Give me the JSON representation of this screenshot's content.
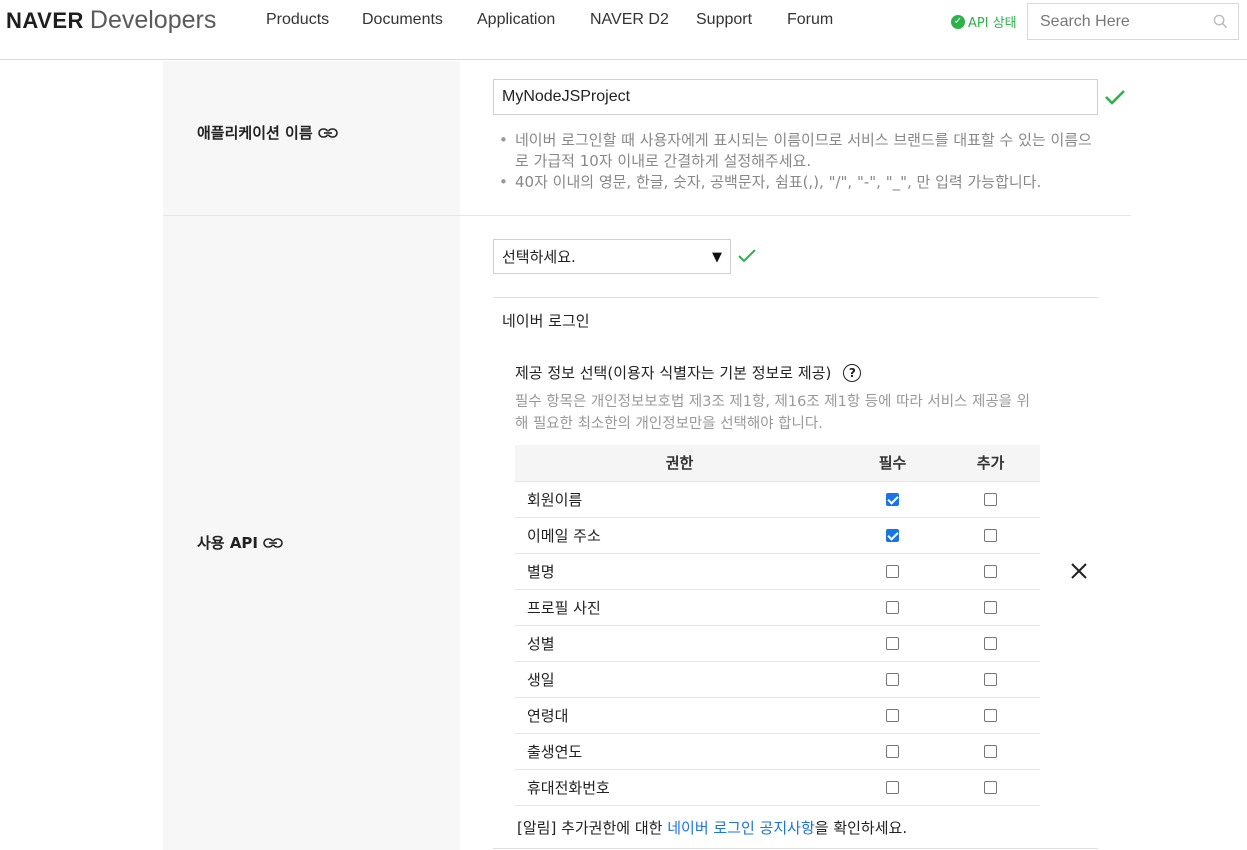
{
  "header": {
    "logo_brand": "NAVER",
    "logo_product": "Developers",
    "nav": [
      "Products",
      "Documents",
      "Application",
      "NAVER D2",
      "Support",
      "Forum"
    ],
    "api_status": "API 상태",
    "search_placeholder": "Search Here"
  },
  "form": {
    "app_name_label": "애플리케이션 이름",
    "app_name_value": "MyNodeJSProject",
    "app_name_notes": [
      "네이버 로그인할 때 사용자에게 표시되는 이름이므로 서비스 브랜드를 대표할 수 있는 이름으로 가급적 10자 이내로 간결하게 설정해주세요.",
      "40자 이내의 영문, 한글, 숫자, 공백문자, 쉼표(,), \"/\", \"-\", \"_\", 만 입력 가능합니다."
    ],
    "api_label": "사용 API",
    "select_value": "선택하세요.",
    "api_name": "네이버 로그인",
    "provide_title": "제공 정보 선택(이용자 식별자는 기본 정보로 제공)",
    "provide_desc": "필수 항목은 개인정보보호법 제3조 제1항, 제16조 제1항 등에 따라 서비스 제공을 위해 필요한 최소한의 개인정보만을 선택해야 합니다.",
    "table_headers": {
      "permission": "권한",
      "required": "필수",
      "additional": "추가"
    },
    "permissions": [
      {
        "name": "회원이름",
        "required": true,
        "additional": false
      },
      {
        "name": "이메일 주소",
        "required": true,
        "additional": false
      },
      {
        "name": "별명",
        "required": false,
        "additional": false
      },
      {
        "name": "프로필 사진",
        "required": false,
        "additional": false
      },
      {
        "name": "성별",
        "required": false,
        "additional": false
      },
      {
        "name": "생일",
        "required": false,
        "additional": false
      },
      {
        "name": "연령대",
        "required": false,
        "additional": false
      },
      {
        "name": "출생연도",
        "required": false,
        "additional": false
      },
      {
        "name": "휴대전화번호",
        "required": false,
        "additional": false
      }
    ],
    "notice_prefix": "[알림] 추가권한에 대한 ",
    "notice_link": "네이버 로그인 공지사항",
    "notice_suffix": "을 확인하세요."
  },
  "colors": {
    "accent_green": "#2bb34a",
    "link_blue": "#1a73e8",
    "label_bg": "#f7f7f7"
  }
}
